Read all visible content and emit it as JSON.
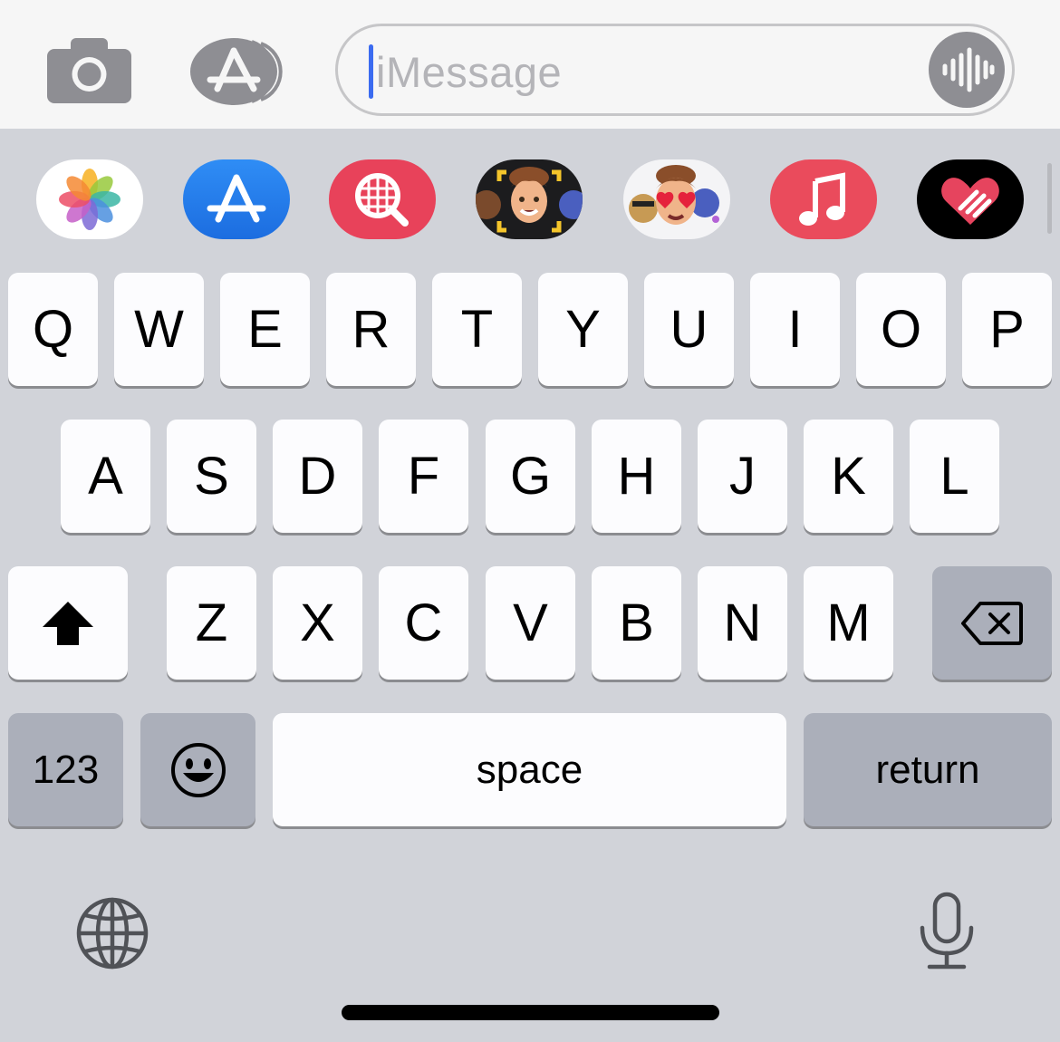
{
  "message_field": {
    "placeholder": "iMessage"
  },
  "toolbar_icons": [
    "camera-icon",
    "app-store-icon",
    "waveform-icon"
  ],
  "app_drawer": [
    {
      "name": "photos-icon"
    },
    {
      "name": "app-store-icon"
    },
    {
      "name": "images-search-icon"
    },
    {
      "name": "memoji-icon"
    },
    {
      "name": "memoji-stickers-icon"
    },
    {
      "name": "music-icon"
    },
    {
      "name": "digital-touch-icon"
    }
  ],
  "keyboard": {
    "row1": [
      "Q",
      "W",
      "E",
      "R",
      "T",
      "Y",
      "U",
      "I",
      "O",
      "P"
    ],
    "row2": [
      "A",
      "S",
      "D",
      "F",
      "G",
      "H",
      "J",
      "K",
      "L"
    ],
    "row3": [
      "Z",
      "X",
      "C",
      "V",
      "B",
      "N",
      "M"
    ],
    "numbers_label": "123",
    "space_label": "space",
    "return_label": "return",
    "icons": [
      "shift-icon",
      "delete-icon",
      "emoji-icon",
      "globe-icon",
      "microphone-icon"
    ]
  },
  "colors": {
    "keyboard_bg": "#d1d3d9",
    "key_bg": "#fcfcfe",
    "function_key_bg": "#abafba",
    "caret": "#3b6bf0"
  }
}
